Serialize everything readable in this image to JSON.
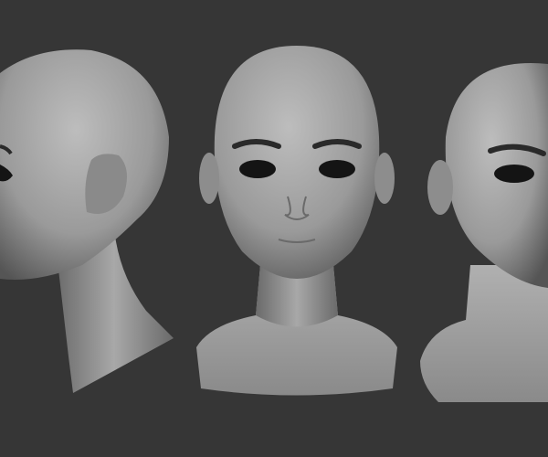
{
  "colors": {
    "background": "#363636",
    "skin_light": "#b8b8b8",
    "skin_dark": "#5a5a5a",
    "eye": "#141414",
    "brow": "#2a2a2a"
  },
  "views": [
    "side",
    "front",
    "three-quarter"
  ]
}
